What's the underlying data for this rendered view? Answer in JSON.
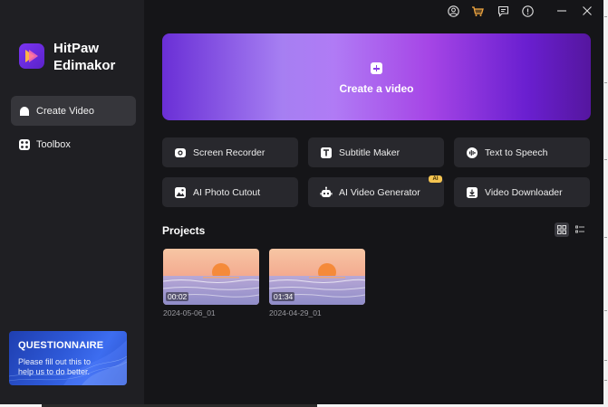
{
  "app": {
    "brand_line1": "HitPaw",
    "brand_line2": "Edimakor"
  },
  "sidebar": {
    "items": [
      {
        "label": "Create Video",
        "active": true,
        "icon": "home-icon"
      },
      {
        "label": "Toolbox",
        "active": false,
        "icon": "toolbox-icon"
      }
    ],
    "promo": {
      "title": "QUESTIONNAIRE",
      "text": "Please fill out this to help us to do better."
    }
  },
  "titlebar": {
    "icons": [
      "account-icon",
      "cart-icon",
      "feedback-icon",
      "info-icon",
      "minimize-icon",
      "close-icon"
    ]
  },
  "hero": {
    "label": "Create a video"
  },
  "tools": [
    {
      "label": "Screen Recorder",
      "icon": "screen-recorder-icon"
    },
    {
      "label": "Subtitle Maker",
      "icon": "subtitle-icon"
    },
    {
      "label": "Text to Speech",
      "icon": "speech-icon"
    },
    {
      "label": "AI Photo Cutout",
      "icon": "photo-cutout-icon"
    },
    {
      "label": "AI Video Generator",
      "icon": "robot-icon",
      "badge": "AI"
    },
    {
      "label": "Video Downloader",
      "icon": "download-icon"
    }
  ],
  "projects": {
    "title": "Projects",
    "items": [
      {
        "name": "2024-05-06_01",
        "duration": "00:02"
      },
      {
        "name": "2024-04-29_01",
        "duration": "01:34"
      }
    ]
  },
  "colors": {
    "window_bg": "#151518",
    "sidebar_bg": "#1f1f23",
    "tool_bg": "#28282d",
    "accent_purple": "#8a3fe6",
    "promo_blue": "#2e59d8"
  }
}
